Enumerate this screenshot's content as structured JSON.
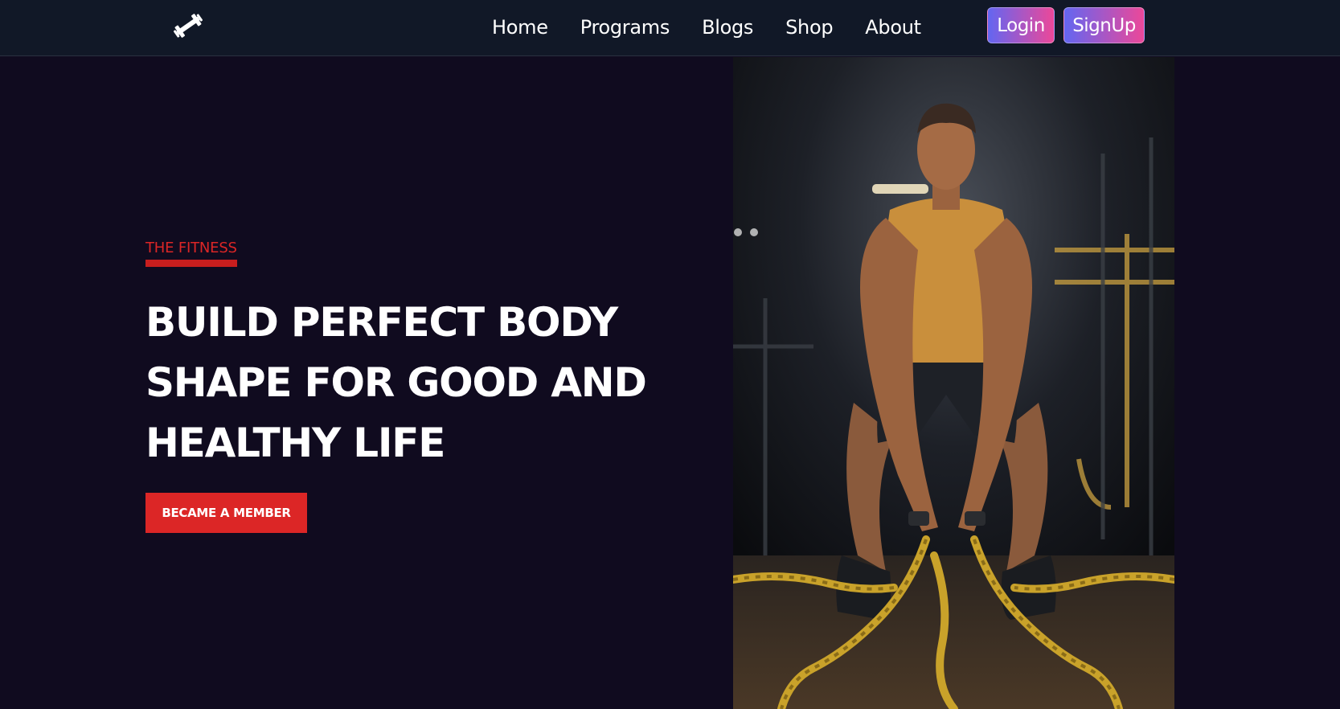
{
  "header": {
    "logo_icon": "dumbbell-icon",
    "nav": [
      "Home",
      "Programs",
      "Blogs",
      "Shop",
      "About"
    ],
    "login_label": "Login",
    "signup_label": "SignUp"
  },
  "hero": {
    "eyebrow": "THE FITNESS",
    "headline_lines": [
      "BUILD PERFECT BODY",
      "SHAPE FOR GOOD AND",
      "HEALTHY LIFE"
    ],
    "cta_label": "BECAME A MEMBER"
  },
  "colors": {
    "background": "#100b1f",
    "navbar": "#111827",
    "accent_red": "#dc2626",
    "gradient_start": "#6366f1",
    "gradient_end": "#ec4899"
  }
}
